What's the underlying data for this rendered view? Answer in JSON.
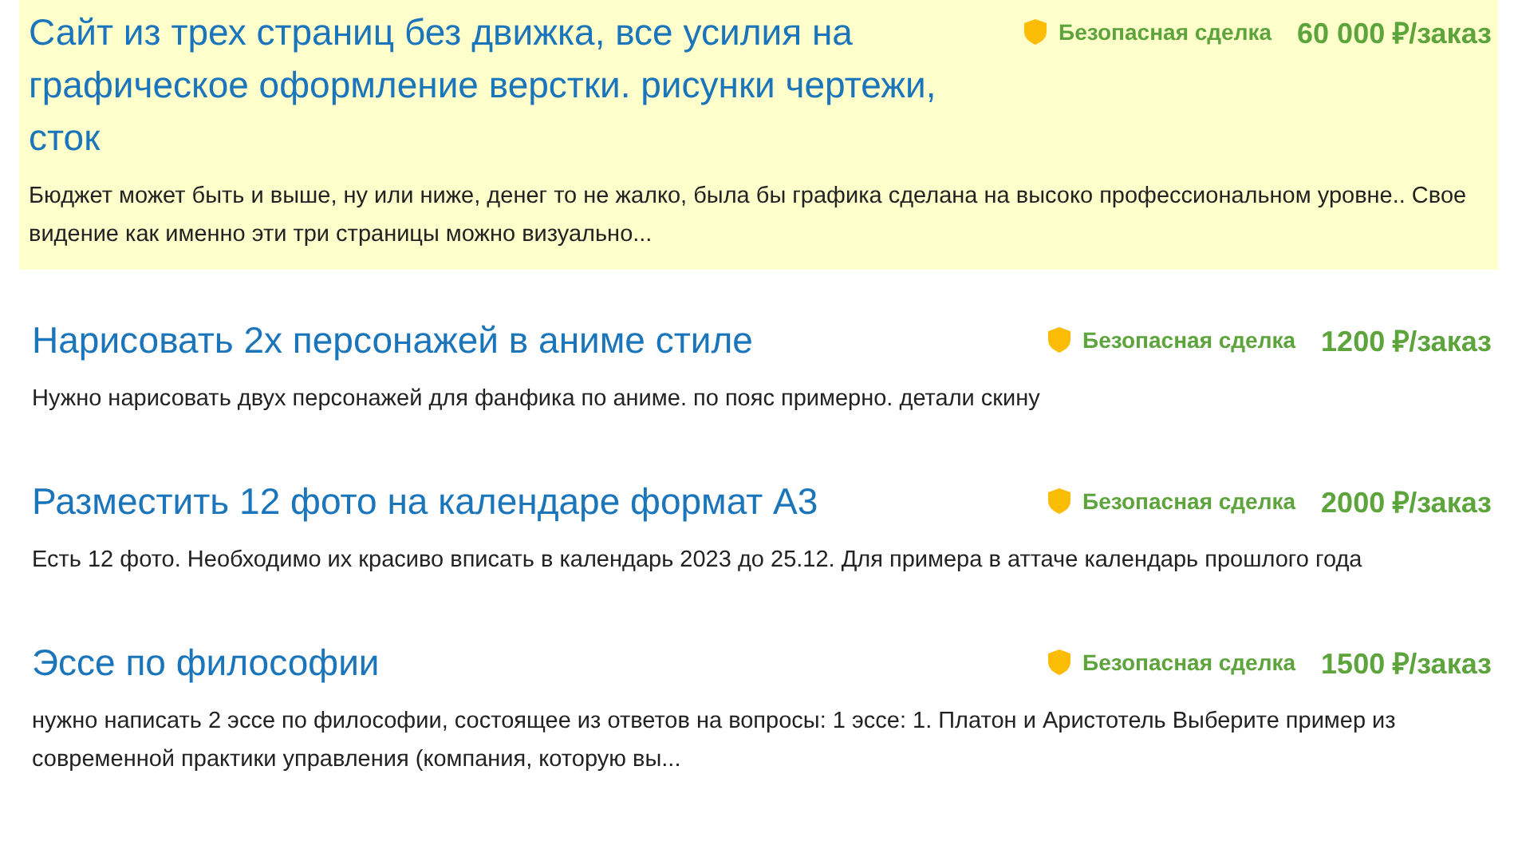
{
  "orders": [
    {
      "title": "Сайт из трех страниц без движка, все усилия на графическое оформление верстки. рисунки чертежи, сток",
      "highlighted": true,
      "safe_deal": "Безопасная сделка",
      "price": "60 000 ₽/заказ",
      "description": "Бюджет может быть и выше, ну или ниже, денег то не жалко, была бы графика сделана на высоко профессиональном уровне.. Свое видение как именно эти три страницы можно визуально..."
    },
    {
      "title": "Нарисовать 2х персонажей в аниме стиле",
      "highlighted": false,
      "safe_deal": "Безопасная сделка",
      "price": "1200 ₽/заказ",
      "description": "Нужно нарисовать двух персонажей для фанфика по аниме. по пояс примерно. детали скину"
    },
    {
      "title": "Разместить 12 фото на календаре формат А3",
      "highlighted": false,
      "safe_deal": "Безопасная сделка",
      "price": "2000 ₽/заказ",
      "description": "Есть 12 фото. Необходимо их красиво вписать в календарь 2023 до 25.12. Для примера в аттаче календарь прошлого года"
    },
    {
      "title": "Эссе по философии",
      "highlighted": false,
      "safe_deal": "Безопасная сделка",
      "price": "1500 ₽/заказ",
      "description": "нужно написать 2 эссе по философии, состоящее из ответов на вопросы:  1 эссе:  1. Платон и Аристотель Выберите пример из современной практики управления (компания, которую вы..."
    }
  ]
}
